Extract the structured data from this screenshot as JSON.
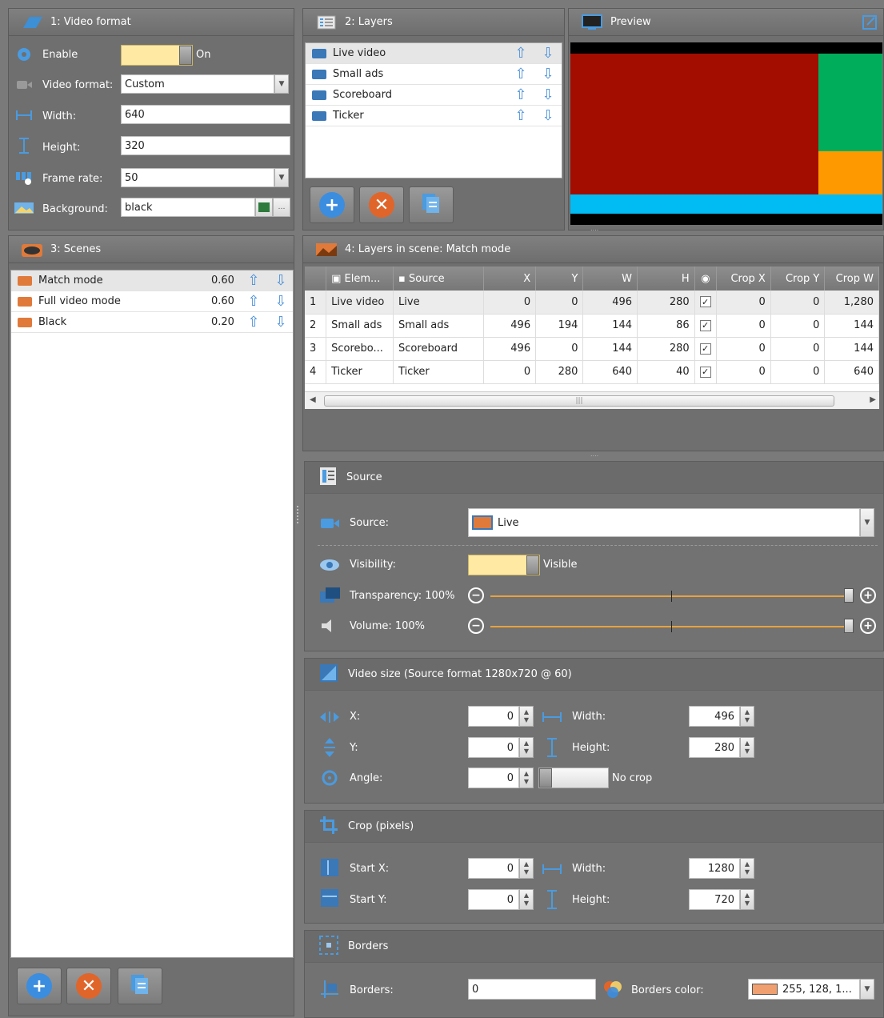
{
  "video_format": {
    "title": "1: Video format",
    "enable_label": "Enable",
    "enable_state": "On",
    "format_label": "Video format:",
    "format_value": "Custom",
    "width_label": "Width:",
    "width_value": "640",
    "height_label": "Height:",
    "height_value": "320",
    "framerate_label": "Frame rate:",
    "framerate_value": "50",
    "background_label": "Background:",
    "background_value": "black"
  },
  "layers": {
    "title": "2: Layers",
    "items": [
      {
        "label": "Live video"
      },
      {
        "label": "Small ads"
      },
      {
        "label": "Scoreboard"
      },
      {
        "label": "Ticker"
      }
    ]
  },
  "preview": {
    "title": "Preview",
    "colors": {
      "main": "#a30d00",
      "right_top": "#00ad5b",
      "right_bottom": "#ff9900",
      "ticker": "#00bcf2",
      "bg": "#000000"
    }
  },
  "scenes": {
    "title": "3: Scenes",
    "items": [
      {
        "label": "Match mode",
        "value": "0.60"
      },
      {
        "label": "Full video mode",
        "value": "0.60"
      },
      {
        "label": "Black",
        "value": "0.20"
      }
    ]
  },
  "layers_in_scene": {
    "title": "4: Layers in scene: Match mode",
    "columns": [
      "Elem...",
      "Source",
      "X",
      "Y",
      "W",
      "H",
      "",
      "Crop X",
      "Crop Y",
      "Crop W"
    ],
    "rows": [
      {
        "n": "1",
        "elem": "Live video",
        "source": "Live",
        "x": "0",
        "y": "0",
        "w": "496",
        "h": "280",
        "cx": "0",
        "cy": "0",
        "cw": "1,280"
      },
      {
        "n": "2",
        "elem": "Small ads",
        "source": "Small ads",
        "x": "496",
        "y": "194",
        "w": "144",
        "h": "86",
        "cx": "0",
        "cy": "0",
        "cw": "144"
      },
      {
        "n": "3",
        "elem": "Scorebo...",
        "source": "Scoreboard",
        "x": "496",
        "y": "0",
        "w": "144",
        "h": "280",
        "cx": "0",
        "cy": "0",
        "cw": "144"
      },
      {
        "n": "4",
        "elem": "Ticker",
        "source": "Ticker",
        "x": "0",
        "y": "280",
        "w": "640",
        "h": "40",
        "cx": "0",
        "cy": "0",
        "cw": "640"
      }
    ],
    "scroll_grip": "|||"
  },
  "source_section": {
    "title": "Source",
    "source_label": "Source:",
    "source_value": "Live",
    "visibility_label": "Visibility:",
    "visibility_state": "Visible",
    "transparency_label": "Transparency: 100%",
    "volume_label": "Volume: 100%",
    "transparency_level": 1.0,
    "volume_level": 1.0
  },
  "video_size": {
    "title": "Video size (Source format 1280x720 @ 60)",
    "x_label": "X:",
    "x_value": "0",
    "y_label": "Y:",
    "y_value": "0",
    "angle_label": "Angle:",
    "angle_value": "0",
    "width_label": "Width:",
    "width_value": "496",
    "height_label": "Height:",
    "height_value": "280",
    "crop_toggle": "No crop"
  },
  "crop": {
    "title": "Crop (pixels)",
    "startx_label": "Start X:",
    "startx_value": "0",
    "starty_label": "Start Y:",
    "starty_value": "0",
    "width_label": "Width:",
    "width_value": "1280",
    "height_label": "Height:",
    "height_value": "720"
  },
  "borders": {
    "title": "Borders",
    "borders_label": "Borders:",
    "borders_value": "0",
    "color_label": "Borders color:",
    "color_value": "255, 128, 1...",
    "swatch": "#f0a070"
  }
}
